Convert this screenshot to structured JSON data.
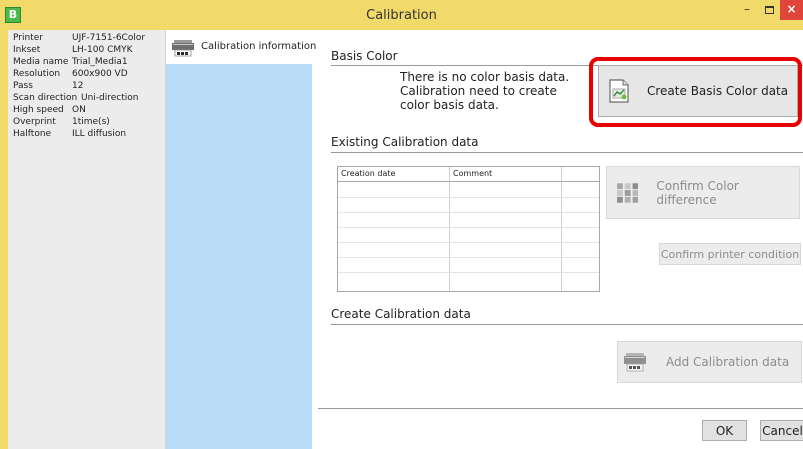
{
  "window": {
    "title": "Calibration",
    "app_icon_letter": "B",
    "controls": {
      "minimize": "–",
      "close": "×"
    }
  },
  "printer_info": [
    {
      "key": "Printer",
      "value": "UJF-7151-6Color"
    },
    {
      "key": "Inkset",
      "value": "LH-100 CMYK"
    },
    {
      "key": "Media name",
      "value": "Trial_Media1"
    },
    {
      "key": "Resolution",
      "value": "600x900 VD"
    },
    {
      "key": "Pass",
      "value": "12"
    },
    {
      "key": "Scan direction",
      "value": "Uni-direction"
    },
    {
      "key": "High speed",
      "value": "ON"
    },
    {
      "key": "Overprint",
      "value": "1time(s)"
    },
    {
      "key": "Halftone",
      "value": "ILL diffusion"
    }
  ],
  "nav": {
    "items": [
      {
        "label": "Calibration information",
        "icon": "printer-icon"
      }
    ]
  },
  "basis_color": {
    "section_title": "Basis Color",
    "message": "There is no color basis data. Calibration need to create color basis data.",
    "create_button": "Create Basis Color data",
    "create_icon": "basis-color-document-icon",
    "highlight_color": "#e60000"
  },
  "existing": {
    "section_title": "Existing Calibration data",
    "table_headers": [
      "Creation date",
      "Comment",
      ""
    ],
    "confirm_color_button": "Confirm Color difference",
    "confirm_color_icon": "color-patch-grid-icon",
    "confirm_printer_button": "Confirm printer condition"
  },
  "create": {
    "section_title": "Create Calibration data",
    "add_button": "Add Calibration data",
    "add_icon": "printer-icon"
  },
  "footer": {
    "ok": "OK",
    "cancel": "Cancel"
  },
  "colors": {
    "titlebar": "#f2da6a",
    "nav_panel": "#b9dcf8",
    "info_panel": "#ececec",
    "close_button": "#e0453c"
  }
}
